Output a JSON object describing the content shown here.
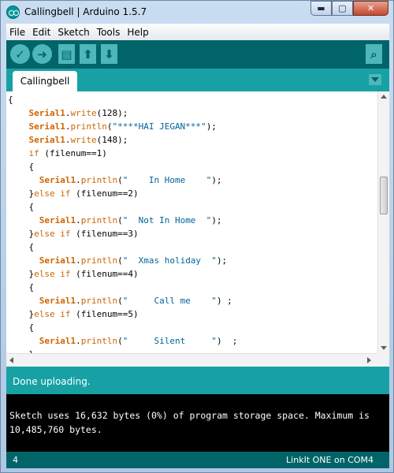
{
  "window": {
    "title": "Callingbell | Arduino 1.5.7",
    "min_glyph": "▬",
    "max_glyph": "▢",
    "close_glyph": "✕"
  },
  "menu": [
    "File",
    "Edit",
    "Sketch",
    "Tools",
    "Help"
  ],
  "toolbar": {
    "verify_icon": "checkmark-icon",
    "upload_icon": "arrow-right-icon",
    "new_icon": "new-file-icon",
    "open_icon": "arrow-up-icon",
    "save_icon": "arrow-down-icon",
    "serial_icon": "magnifier-icon",
    "verify_glyph": "✓",
    "upload_glyph": "➜",
    "new_glyph": "▤",
    "open_glyph": "⬆",
    "save_glyph": "⬇",
    "serial_glyph": "⌕"
  },
  "tab": {
    "name": "Callingbell"
  },
  "code_lines": [
    [
      {
        "t": "{",
        "c": ""
      }
    ],
    [
      {
        "t": "    ",
        "c": ""
      },
      {
        "t": "Serial1",
        "c": "kw-obj"
      },
      {
        "t": ".",
        "c": ""
      },
      {
        "t": "write",
        "c": "kw-fn"
      },
      {
        "t": "(128);",
        "c": ""
      }
    ],
    [
      {
        "t": "    ",
        "c": ""
      },
      {
        "t": "Serial1",
        "c": "kw-obj"
      },
      {
        "t": ".",
        "c": ""
      },
      {
        "t": "println",
        "c": "kw-fn"
      },
      {
        "t": "(",
        "c": ""
      },
      {
        "t": "\"****HAI JEGAN***\"",
        "c": "str"
      },
      {
        "t": ");",
        "c": ""
      }
    ],
    [
      {
        "t": "    ",
        "c": ""
      },
      {
        "t": "Serial1",
        "c": "kw-obj"
      },
      {
        "t": ".",
        "c": ""
      },
      {
        "t": "write",
        "c": "kw-fn"
      },
      {
        "t": "(148);",
        "c": ""
      }
    ],
    [
      {
        "t": "    ",
        "c": ""
      },
      {
        "t": "if",
        "c": "kw-if"
      },
      {
        "t": " (filenum==1)",
        "c": ""
      }
    ],
    [
      {
        "t": "    {",
        "c": ""
      }
    ],
    [
      {
        "t": "      ",
        "c": ""
      },
      {
        "t": "Serial1",
        "c": "kw-obj"
      },
      {
        "t": ".",
        "c": ""
      },
      {
        "t": "println",
        "c": "kw-fn"
      },
      {
        "t": "(",
        "c": ""
      },
      {
        "t": "\"    In Home    \"",
        "c": "str"
      },
      {
        "t": ");",
        "c": ""
      }
    ],
    [
      {
        "t": "    }",
        "c": ""
      },
      {
        "t": "else if",
        "c": "kw-if"
      },
      {
        "t": " (filenum==2)",
        "c": ""
      }
    ],
    [
      {
        "t": "    {",
        "c": ""
      }
    ],
    [
      {
        "t": "      ",
        "c": ""
      },
      {
        "t": "Serial1",
        "c": "kw-obj"
      },
      {
        "t": ".",
        "c": ""
      },
      {
        "t": "println",
        "c": "kw-fn"
      },
      {
        "t": "(",
        "c": ""
      },
      {
        "t": "\"  Not In Home  \"",
        "c": "str"
      },
      {
        "t": ");",
        "c": ""
      }
    ],
    [
      {
        "t": "    }",
        "c": ""
      },
      {
        "t": "else if",
        "c": "kw-if"
      },
      {
        "t": " (filenum==3)",
        "c": ""
      }
    ],
    [
      {
        "t": "    {",
        "c": ""
      }
    ],
    [
      {
        "t": "      ",
        "c": ""
      },
      {
        "t": "Serial1",
        "c": "kw-obj"
      },
      {
        "t": ".",
        "c": ""
      },
      {
        "t": "println",
        "c": "kw-fn"
      },
      {
        "t": "(",
        "c": ""
      },
      {
        "t": "\"  Xmas holiday  \"",
        "c": "str"
      },
      {
        "t": ");",
        "c": ""
      }
    ],
    [
      {
        "t": "    }",
        "c": ""
      },
      {
        "t": "else if",
        "c": "kw-if"
      },
      {
        "t": " (filenum==4)",
        "c": ""
      }
    ],
    [
      {
        "t": "    {",
        "c": ""
      }
    ],
    [
      {
        "t": "      ",
        "c": ""
      },
      {
        "t": "Serial1",
        "c": "kw-obj"
      },
      {
        "t": ".",
        "c": ""
      },
      {
        "t": "println",
        "c": "kw-fn"
      },
      {
        "t": "(",
        "c": ""
      },
      {
        "t": "\"     Call me    \"",
        "c": "str"
      },
      {
        "t": ") ;",
        "c": ""
      }
    ],
    [
      {
        "t": "    }",
        "c": ""
      },
      {
        "t": "else if",
        "c": "kw-if"
      },
      {
        "t": " (filenum==5)",
        "c": ""
      }
    ],
    [
      {
        "t": "    {",
        "c": ""
      }
    ],
    [
      {
        "t": "      ",
        "c": ""
      },
      {
        "t": "Serial1",
        "c": "kw-obj"
      },
      {
        "t": ".",
        "c": ""
      },
      {
        "t": "println",
        "c": "kw-fn"
      },
      {
        "t": "(",
        "c": ""
      },
      {
        "t": "\"     Silent     \"",
        "c": "str"
      },
      {
        "t": ")  ;",
        "c": ""
      }
    ],
    [
      {
        "t": "    }",
        "c": ""
      }
    ]
  ],
  "status": {
    "message": "Done uploading."
  },
  "console": {
    "text": "Sketch uses 16,632 bytes (0%) of program storage space. Maximum is 10,485,760 bytes."
  },
  "footer": {
    "line_number": "4",
    "board": "LinkIt ONE on COM4"
  },
  "colors": {
    "teal_dark": "#006468",
    "teal_mid": "#17a1a5",
    "teal_light": "#4db7bb",
    "keyword_orange": "#cc6600",
    "string_blue": "#006699"
  }
}
